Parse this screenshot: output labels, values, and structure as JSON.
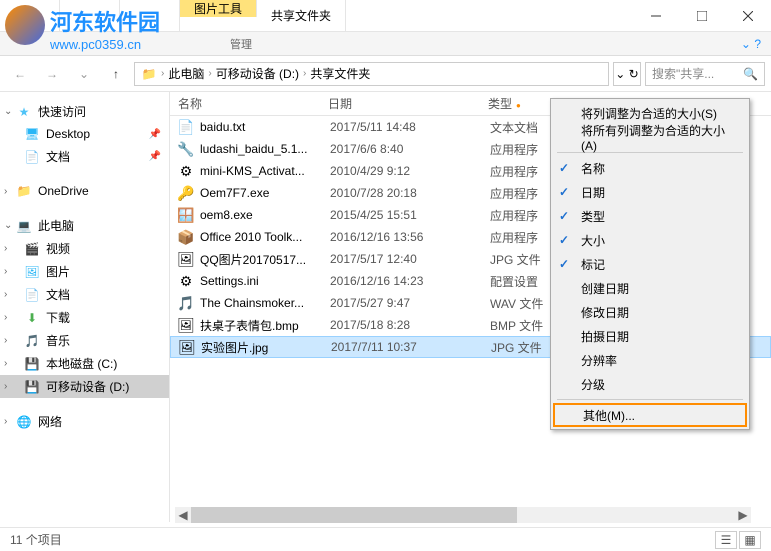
{
  "watermark": {
    "title": "河东软件园",
    "url": "www.pc0359.cn"
  },
  "titlebar": {
    "tab_tools": "图片工具",
    "tab_folder": "共享文件夹",
    "sub_manage": "管理"
  },
  "ribbon": {
    "manage": "管理"
  },
  "breadcrumb": {
    "root": "此电脑",
    "drive": "可移动设备 (D:)",
    "folder": "共享文件夹"
  },
  "search": {
    "placeholder": "搜索\"共享..."
  },
  "sidebar": {
    "quick": "快速访问",
    "desktop": "Desktop",
    "docs": "文档",
    "onedrive": "OneDrive",
    "thispc": "此电脑",
    "video": "视频",
    "pics": "图片",
    "docs2": "文档",
    "download": "下载",
    "music": "音乐",
    "localdisk": "本地磁盘 (C:)",
    "removable": "可移动设备 (D:)",
    "network": "网络"
  },
  "columns": {
    "name": "名称",
    "date": "日期",
    "type": "类型"
  },
  "files": [
    {
      "name": "baidu.txt",
      "date": "2017/5/11 14:48",
      "type": "文本文档",
      "icon": "📄"
    },
    {
      "name": "ludashi_baidu_5.1...",
      "date": "2017/6/6 8:40",
      "type": "应用程序",
      "icon": "🔧"
    },
    {
      "name": "mini-KMS_Activat...",
      "date": "2010/4/29 9:12",
      "type": "应用程序",
      "icon": "⚙"
    },
    {
      "name": "Oem7F7.exe",
      "date": "2010/7/28 20:18",
      "type": "应用程序",
      "icon": "🔑"
    },
    {
      "name": "oem8.exe",
      "date": "2015/4/25 15:51",
      "type": "应用程序",
      "icon": "🪟"
    },
    {
      "name": "Office 2010 Toolk...",
      "date": "2016/12/16 13:56",
      "type": "应用程序",
      "icon": "📦"
    },
    {
      "name": "QQ图片20170517...",
      "date": "2017/5/17 12:40",
      "type": "JPG 文件",
      "icon": "🖼"
    },
    {
      "name": "Settings.ini",
      "date": "2016/12/16 14:23",
      "type": "配置设置",
      "icon": "⚙"
    },
    {
      "name": "The Chainsmoker...",
      "date": "2017/5/27 9:47",
      "type": "WAV 文件",
      "icon": "🎵"
    },
    {
      "name": "扶桌子表情包.bmp",
      "date": "2017/5/18 8:28",
      "type": "BMP 文件",
      "icon": "🖼"
    },
    {
      "name": "实验图片.jpg",
      "date": "2017/7/11 10:37",
      "type": "JPG 文件",
      "icon": "🖼",
      "selected": true
    }
  ],
  "menu": {
    "fit_column": "将列调整为合适的大小(S)",
    "fit_all": "将所有列调整为合适的大小(A)",
    "name": "名称",
    "date": "日期",
    "type": "类型",
    "size": "大小",
    "tags": "标记",
    "created": "创建日期",
    "modified": "修改日期",
    "taken": "拍摄日期",
    "resolution": "分辨率",
    "rating": "分级",
    "other": "其他(M)..."
  },
  "status": {
    "count": "11 个项目"
  }
}
